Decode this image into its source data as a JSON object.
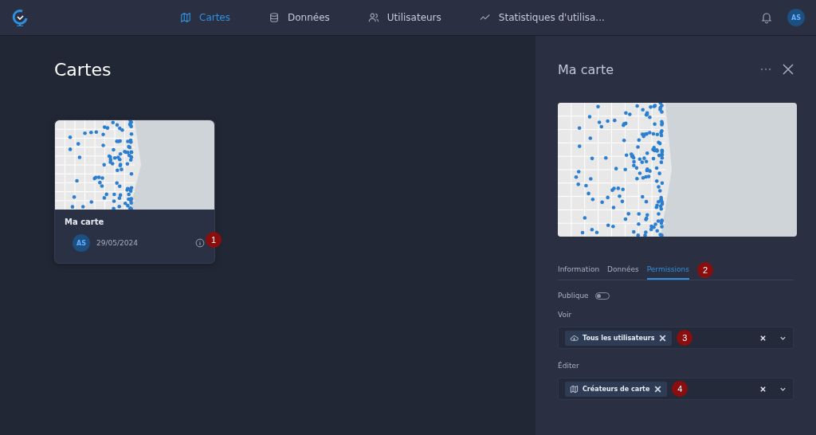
{
  "nav": {
    "items": [
      {
        "label": "Cartes",
        "kind": "map",
        "selected": true
      },
      {
        "label": "Données",
        "kind": "database",
        "selected": false
      },
      {
        "label": "Utilisateurs",
        "kind": "users",
        "selected": false
      },
      {
        "label": "Statistiques d'utilisa...",
        "kind": "chart",
        "selected": false
      }
    ],
    "avatar": "AS"
  },
  "page": {
    "title": "Cartes",
    "cards": [
      {
        "title": "Ma carte",
        "avatar": "AS",
        "date": "29/05/2024",
        "callout": "1"
      }
    ]
  },
  "panel": {
    "title": "Ma carte",
    "tabs": [
      {
        "label": "Information",
        "selected": false
      },
      {
        "label": "Données",
        "selected": false
      },
      {
        "label": "Permissions",
        "selected": true
      }
    ],
    "tabs_callout": "2",
    "public": {
      "label": "Publique",
      "on": false
    },
    "fields": [
      {
        "label": "Voir",
        "chip": "Tous les utilisateurs",
        "kind": "cloud",
        "callout": "3"
      },
      {
        "label": "Éditer",
        "chip": "Créateurs de carte",
        "kind": "map",
        "callout": "4"
      }
    ]
  }
}
